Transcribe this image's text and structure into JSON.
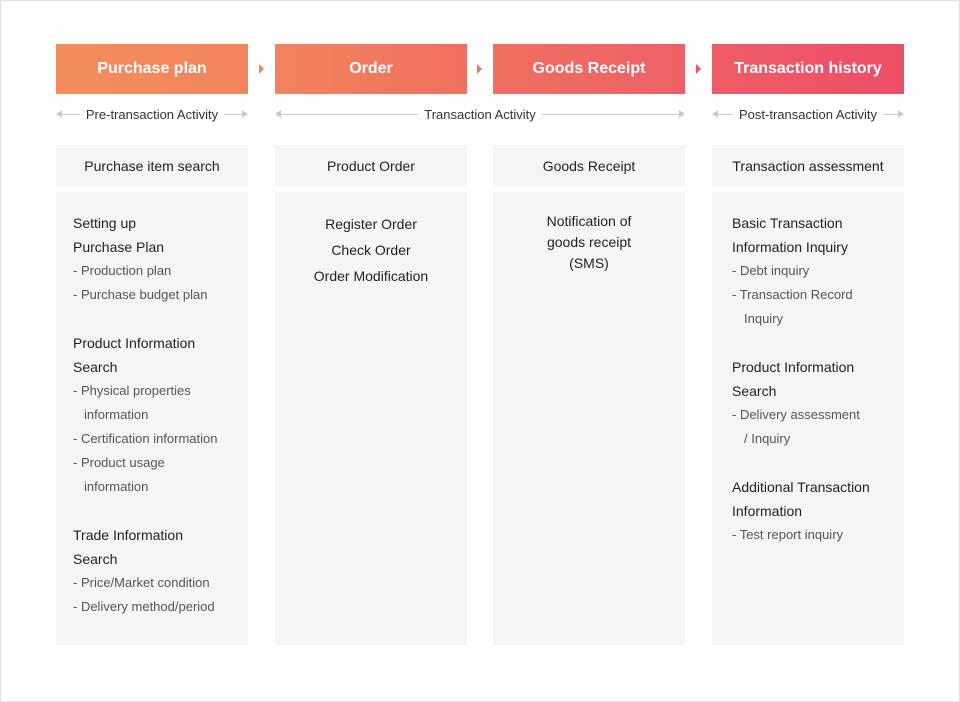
{
  "stages": [
    {
      "label": "Purchase plan",
      "color": "#f48d5b"
    },
    {
      "label": "Order",
      "color": "#f07a5e"
    },
    {
      "label": "Goods Receipt",
      "color": "#ee6663"
    },
    {
      "label": "Transaction history",
      "color": "#ec5267"
    }
  ],
  "phases": [
    {
      "label": "Pre-transaction Activity"
    },
    {
      "label": "Transaction Activity"
    },
    {
      "label": "Post-transaction Activity"
    }
  ],
  "columns": [
    {
      "subheader": "Purchase item search",
      "groups": [
        {
          "title": [
            "Setting up",
            "Purchase Plan"
          ],
          "items": [
            "- Production plan",
            "- Purchase budget plan"
          ]
        },
        {
          "title": [
            "Product Information",
            "Search"
          ],
          "items": [
            "- Physical properties",
            "   information",
            "- Certification information",
            "- Product usage",
            "   information"
          ]
        },
        {
          "title": [
            "Trade Information",
            "Search"
          ],
          "items": [
            "- Price/Market condition",
            "- Delivery method/period"
          ]
        }
      ]
    },
    {
      "subheader": "Product Order",
      "lines": [
        "Register Order",
        "Check Order",
        "Order Modification"
      ]
    },
    {
      "subheader": "Goods Receipt",
      "lines": [
        "Notification of",
        "goods receipt",
        "(SMS)"
      ]
    },
    {
      "subheader": "Transaction assessment",
      "groups": [
        {
          "title": [
            "Basic Transaction",
            "Information Inquiry"
          ],
          "items": [
            "- Debt inquiry",
            "- Transaction Record",
            "   Inquiry"
          ]
        },
        {
          "title": [
            "Product Information",
            "Search"
          ],
          "items": [
            "- Delivery assessment",
            "   / Inquiry"
          ]
        },
        {
          "title": [
            "Additional Transaction",
            "Information"
          ],
          "items": [
            "- Test report inquiry"
          ]
        }
      ]
    }
  ]
}
